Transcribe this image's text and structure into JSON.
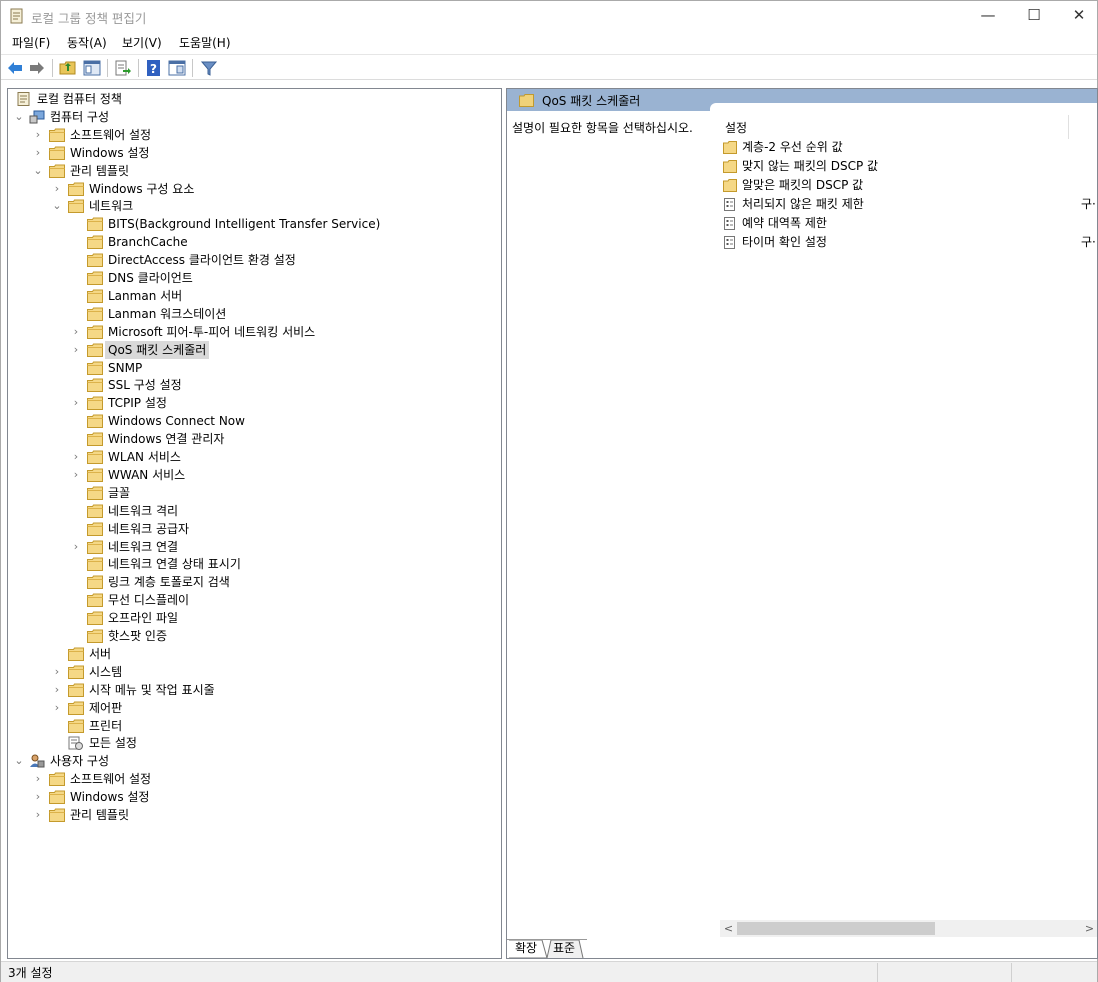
{
  "window": {
    "title": "로컬 그룹 정책 편집기"
  },
  "menu": [
    "파일(F)",
    "동작(A)",
    "보기(V)",
    "도움말(H)"
  ],
  "tree": [
    {
      "label": "로컬 컴퓨터 정책",
      "depth": 0,
      "chevron": "",
      "icon": "policy"
    },
    {
      "label": "컴퓨터 구성",
      "depth": 0,
      "chevron": "down",
      "icon": "computer"
    },
    {
      "label": "소프트웨어 설정",
      "depth": 1,
      "chevron": "right",
      "icon": "folder"
    },
    {
      "label": "Windows 설정",
      "depth": 1,
      "chevron": "right",
      "icon": "folder"
    },
    {
      "label": "관리 템플릿",
      "depth": 1,
      "chevron": "down",
      "icon": "folder"
    },
    {
      "label": "Windows 구성 요소",
      "depth": 2,
      "chevron": "right",
      "icon": "folder"
    },
    {
      "label": "네트워크",
      "depth": 2,
      "chevron": "down",
      "icon": "folder"
    },
    {
      "label": "BITS(Background Intelligent Transfer Service)",
      "depth": 3,
      "chevron": "",
      "icon": "folder"
    },
    {
      "label": "BranchCache",
      "depth": 3,
      "chevron": "",
      "icon": "folder"
    },
    {
      "label": "DirectAccess 클라이언트 환경 설정",
      "depth": 3,
      "chevron": "",
      "icon": "folder"
    },
    {
      "label": "DNS 클라이언트",
      "depth": 3,
      "chevron": "",
      "icon": "folder"
    },
    {
      "label": "Lanman 서버",
      "depth": 3,
      "chevron": "",
      "icon": "folder"
    },
    {
      "label": "Lanman 워크스테이션",
      "depth": 3,
      "chevron": "",
      "icon": "folder"
    },
    {
      "label": "Microsoft 피어-투-피어 네트워킹 서비스",
      "depth": 3,
      "chevron": "right",
      "icon": "folder"
    },
    {
      "label": "QoS 패킷 스케줄러",
      "depth": 3,
      "chevron": "right",
      "icon": "folder",
      "selected": true
    },
    {
      "label": "SNMP",
      "depth": 3,
      "chevron": "",
      "icon": "folder"
    },
    {
      "label": "SSL 구성 설정",
      "depth": 3,
      "chevron": "",
      "icon": "folder"
    },
    {
      "label": "TCPIP 설정",
      "depth": 3,
      "chevron": "right",
      "icon": "folder"
    },
    {
      "label": "Windows Connect Now",
      "depth": 3,
      "chevron": "",
      "icon": "folder"
    },
    {
      "label": "Windows 연결 관리자",
      "depth": 3,
      "chevron": "",
      "icon": "folder"
    },
    {
      "label": "WLAN 서비스",
      "depth": 3,
      "chevron": "right",
      "icon": "folder"
    },
    {
      "label": "WWAN 서비스",
      "depth": 3,
      "chevron": "right",
      "icon": "folder"
    },
    {
      "label": "글꼴",
      "depth": 3,
      "chevron": "",
      "icon": "folder"
    },
    {
      "label": "네트워크 격리",
      "depth": 3,
      "chevron": "",
      "icon": "folder"
    },
    {
      "label": "네트워크 공급자",
      "depth": 3,
      "chevron": "",
      "icon": "folder"
    },
    {
      "label": "네트워크 연결",
      "depth": 3,
      "chevron": "right",
      "icon": "folder"
    },
    {
      "label": "네트워크 연결 상태 표시기",
      "depth": 3,
      "chevron": "",
      "icon": "folder"
    },
    {
      "label": "링크 계층 토폴로지 검색",
      "depth": 3,
      "chevron": "",
      "icon": "folder"
    },
    {
      "label": "무선 디스플레이",
      "depth": 3,
      "chevron": "",
      "icon": "folder"
    },
    {
      "label": "오프라인 파일",
      "depth": 3,
      "chevron": "",
      "icon": "folder"
    },
    {
      "label": "핫스팟 인증",
      "depth": 3,
      "chevron": "",
      "icon": "folder"
    },
    {
      "label": "서버",
      "depth": 2,
      "chevron": "",
      "icon": "folder"
    },
    {
      "label": "시스템",
      "depth": 2,
      "chevron": "right",
      "icon": "folder"
    },
    {
      "label": "시작 메뉴 및 작업 표시줄",
      "depth": 2,
      "chevron": "right",
      "icon": "folder"
    },
    {
      "label": "제어판",
      "depth": 2,
      "chevron": "right",
      "icon": "folder"
    },
    {
      "label": "프린터",
      "depth": 2,
      "chevron": "",
      "icon": "folder"
    },
    {
      "label": "모든 설정",
      "depth": 2,
      "chevron": "",
      "icon": "allsettings"
    },
    {
      "label": "사용자 구성",
      "depth": 0,
      "chevron": "down",
      "icon": "user"
    },
    {
      "label": "소프트웨어 설정",
      "depth": 1,
      "chevron": "right",
      "icon": "folder"
    },
    {
      "label": "Windows 설정",
      "depth": 1,
      "chevron": "right",
      "icon": "folder"
    },
    {
      "label": "관리 템플릿",
      "depth": 1,
      "chevron": "right",
      "icon": "folder"
    }
  ],
  "right": {
    "header": "QoS 패킷 스케줄러",
    "description": "설명이 필요한 항목을 선택하십시오.",
    "column": "설정",
    "settings": [
      {
        "label": "계층-2 우선 순위 값",
        "icon": "folder",
        "extra": ""
      },
      {
        "label": "맞지 않는 패킷의 DSCP 값",
        "icon": "folder",
        "extra": ""
      },
      {
        "label": "알맞은 패킷의 DSCP 값",
        "icon": "folder",
        "extra": ""
      },
      {
        "label": "처리되지 않은 패킷 제한",
        "icon": "setting",
        "extra": "구·"
      },
      {
        "label": "예약 대역폭 제한",
        "icon": "setting",
        "extra": ""
      },
      {
        "label": "타이머 확인 설정",
        "icon": "setting",
        "extra": "구·"
      }
    ]
  },
  "tabs": [
    "확장",
    "표준"
  ],
  "status": "3개 설정"
}
